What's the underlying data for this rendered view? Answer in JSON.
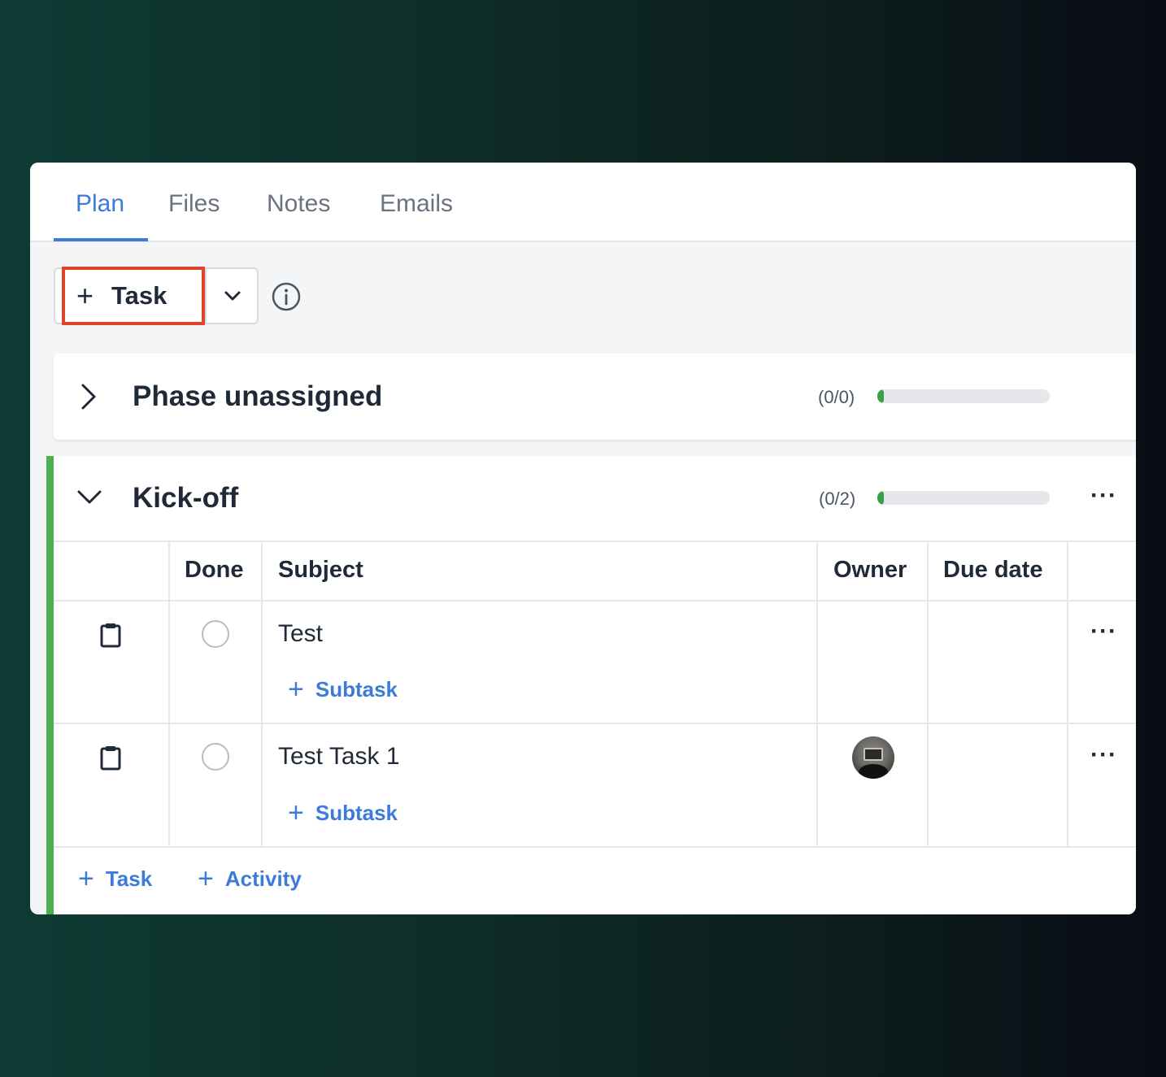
{
  "tabs": [
    {
      "label": "Plan",
      "active": true
    },
    {
      "label": "Files",
      "active": false
    },
    {
      "label": "Notes",
      "active": false
    },
    {
      "label": "Emails",
      "active": false
    }
  ],
  "toolbar": {
    "add_task_label": "Task",
    "highlight_color": "#e0452b"
  },
  "phases": [
    {
      "title": "Phase unassigned",
      "expanded": false,
      "count": "(0/0)",
      "progress": 0
    },
    {
      "title": "Kick-off",
      "expanded": true,
      "count": "(0/2)",
      "progress": 0,
      "accent_color": "#4caf50",
      "columns": [
        "Done",
        "Subject",
        "Owner",
        "Due date"
      ],
      "rows": [
        {
          "subject": "Test",
          "subtask_label": "Subtask",
          "done": false,
          "owner_avatar": false,
          "due_date": ""
        },
        {
          "subject": "Test Task 1",
          "subtask_label": "Subtask",
          "done": false,
          "owner_avatar": true,
          "due_date": ""
        }
      ],
      "footer": {
        "add_task_label": "Task",
        "add_activity_label": "Activity"
      }
    }
  ],
  "colors": {
    "accent": "#3d7bd9",
    "progress": "#3aa14a"
  }
}
